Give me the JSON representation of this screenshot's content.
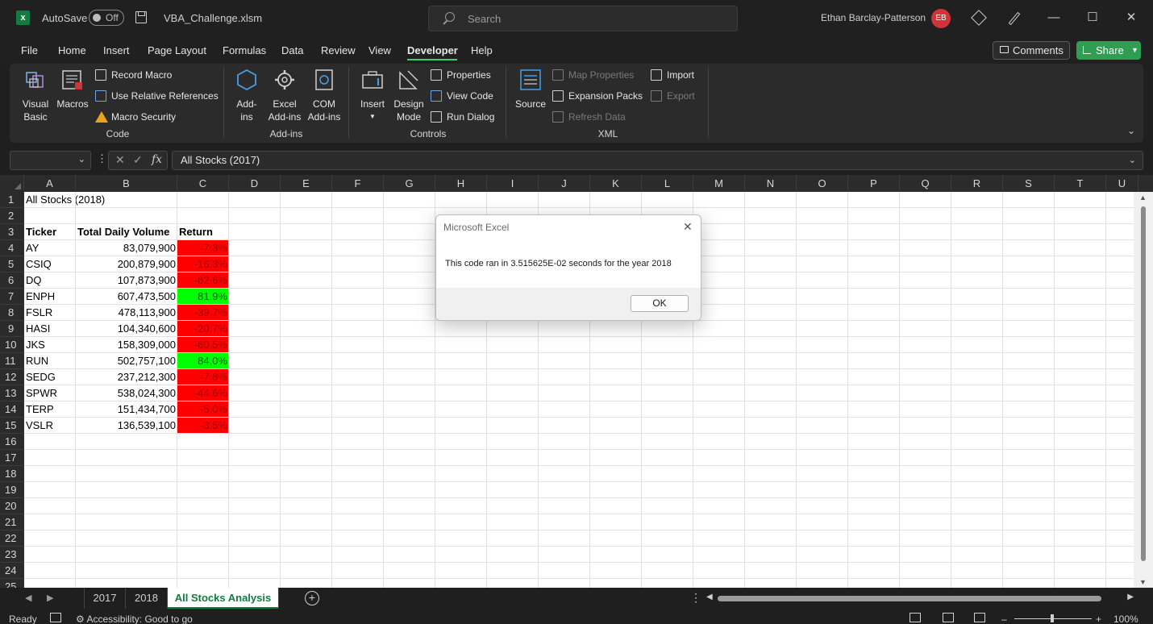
{
  "titlebar": {
    "autosave_label": "AutoSave",
    "autosave_state": "Off",
    "filename": "VBA_Challenge.xlsm",
    "search_placeholder": "Search",
    "username": "Ethan Barclay-Patterson",
    "avatar_initials": "EB"
  },
  "menu": {
    "items": [
      "File",
      "Home",
      "Insert",
      "Page Layout",
      "Formulas",
      "Data",
      "Review",
      "View",
      "Developer",
      "Help"
    ],
    "active": "Developer",
    "comments_label": "Comments",
    "share_label": "Share"
  },
  "ribbon": {
    "code": {
      "group": "Code",
      "visual_basic": "Visual Basic",
      "macros": "Macros",
      "record_macro": "Record Macro",
      "relative_refs": "Use Relative References",
      "macro_security": "Macro Security"
    },
    "addins": {
      "group": "Add-ins",
      "addins": "Add-ins",
      "excel_addins": "Excel Add-ins",
      "com_addins": "COM Add-ins"
    },
    "controls": {
      "group": "Controls",
      "insert": "Insert",
      "design_mode": "Design Mode",
      "properties": "Properties",
      "view_code": "View Code",
      "run_dialog": "Run Dialog"
    },
    "xml": {
      "group": "XML",
      "source": "Source",
      "map_properties": "Map Properties",
      "expansion_packs": "Expansion Packs",
      "refresh_data": "Refresh Data",
      "import": "Import",
      "export": "Export"
    }
  },
  "formula_bar": {
    "name_box": "",
    "formula": "All Stocks (2017)"
  },
  "grid": {
    "columns": [
      "A",
      "B",
      "C",
      "D",
      "E",
      "F",
      "G",
      "H",
      "I",
      "J",
      "K",
      "L",
      "M",
      "N",
      "O",
      "P",
      "Q",
      "R",
      "S",
      "T",
      "U"
    ],
    "rows": [
      "1",
      "2",
      "3",
      "4",
      "5",
      "6",
      "7",
      "8",
      "9",
      "10",
      "11",
      "12",
      "13",
      "14",
      "15",
      "16",
      "17",
      "18",
      "19",
      "20",
      "21",
      "22",
      "23",
      "24",
      "25"
    ],
    "title": "All Stocks (2018)",
    "headers": [
      "Ticker",
      "Total Daily Volume",
      "Return"
    ],
    "data": [
      {
        "ticker": "AY",
        "volume": "83,079,900",
        "ret": "-7.3%",
        "positive": false
      },
      {
        "ticker": "CSIQ",
        "volume": "200,879,900",
        "ret": "-16.3%",
        "positive": false
      },
      {
        "ticker": "DQ",
        "volume": "107,873,900",
        "ret": "-62.6%",
        "positive": false
      },
      {
        "ticker": "ENPH",
        "volume": "607,473,500",
        "ret": "81.9%",
        "positive": true
      },
      {
        "ticker": "FSLR",
        "volume": "478,113,900",
        "ret": "-39.7%",
        "positive": false
      },
      {
        "ticker": "HASI",
        "volume": "104,340,600",
        "ret": "-20.7%",
        "positive": false
      },
      {
        "ticker": "JKS",
        "volume": "158,309,000",
        "ret": "-60.5%",
        "positive": false
      },
      {
        "ticker": "RUN",
        "volume": "502,757,100",
        "ret": "84.0%",
        "positive": true
      },
      {
        "ticker": "SEDG",
        "volume": "237,212,300",
        "ret": "-7.8%",
        "positive": false
      },
      {
        "ticker": "SPWR",
        "volume": "538,024,300",
        "ret": "-44.6%",
        "positive": false
      },
      {
        "ticker": "TERP",
        "volume": "151,434,700",
        "ret": "-5.0%",
        "positive": false
      },
      {
        "ticker": "VSLR",
        "volume": "136,539,100",
        "ret": "-3.5%",
        "positive": false
      }
    ]
  },
  "sheets": {
    "tabs": [
      "2017",
      "2018",
      "All Stocks Analysis"
    ],
    "active": "All Stocks Analysis"
  },
  "status": {
    "ready": "Ready",
    "accessibility": "Accessibility: Good to go",
    "zoom": "100%"
  },
  "dialog": {
    "title": "Microsoft Excel",
    "message": "This code ran in 3.515625E-02 seconds for the year 2018",
    "ok_label": "OK"
  },
  "colors": {
    "excel_green": "#107c41",
    "negative_fill": "#ff0000",
    "positive_fill": "#00ff00",
    "share_green": "#2f9e52"
  }
}
